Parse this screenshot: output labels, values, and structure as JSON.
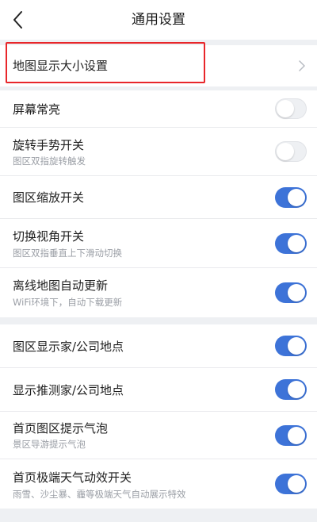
{
  "header": {
    "title": "通用设置",
    "back_icon": "chevron-left-icon"
  },
  "group1": {
    "map_size": {
      "label": "地图显示大小设置",
      "icon": "chevron-right-icon",
      "highlight_color": "#e8262a"
    }
  },
  "group2": {
    "keep_screen_on": {
      "label": "屏幕常亮",
      "on": false
    },
    "rotate_gesture": {
      "label": "旋转手势开关",
      "sub": "图区双指旋转触发",
      "on": false
    },
    "zoom_switch": {
      "label": "图区缩放开关",
      "on": true
    },
    "view_angle": {
      "label": "切换视角开关",
      "sub": "图区双指垂直上下滑动切换",
      "on": true
    },
    "offline_update": {
      "label": "离线地图自动更新",
      "sub": "WiFi环境下，自动下载更新",
      "on": true
    }
  },
  "group3": {
    "show_home_company": {
      "label": "图区显示家/公司地点",
      "on": true
    },
    "predict_home_company": {
      "label": "显示推测家/公司地点",
      "on": true
    },
    "home_bubble": {
      "label": "首页图区提示气泡",
      "sub": "景区导游提示气泡",
      "on": true
    },
    "weather_effect": {
      "label": "首页极端天气动效开关",
      "sub": "雨雪、沙尘暴、霾等极端天气自动展示特效",
      "on": true
    }
  },
  "colors": {
    "accent": "#3d73d8",
    "highlight": "#e8262a",
    "background": "#eef0f3"
  }
}
